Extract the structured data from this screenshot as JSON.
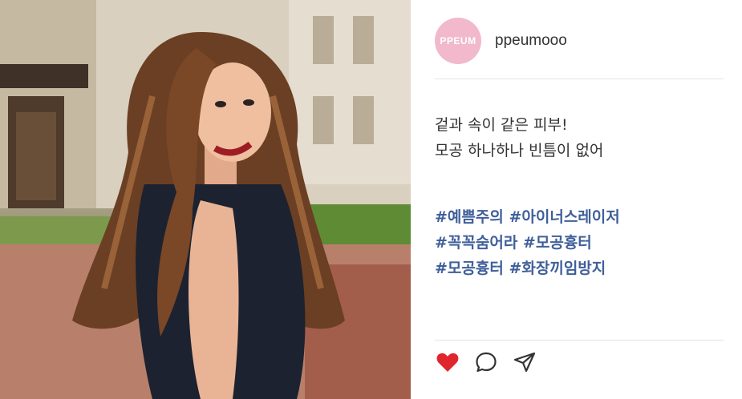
{
  "post": {
    "username": "ppeumooo",
    "avatar_text": "PPEUM",
    "caption_lines": [
      "겉과 속이 같은 피부!",
      "모공 하나하나 빈틈이 없어"
    ],
    "hashtag_lines": [
      "#예쁨주의 #아이너스레이저",
      "#꼭꼭숨어라 #모공흉터",
      "#모공흉터 #화장끼임방지"
    ]
  },
  "actions": {
    "like_icon": "heart-icon",
    "comment_icon": "comment-icon",
    "share_icon": "send-icon"
  },
  "colors": {
    "avatar_bg": "#f2b8cc",
    "hashtag": "#3f5f9a",
    "like": "#e0262c",
    "text": "#333333"
  }
}
